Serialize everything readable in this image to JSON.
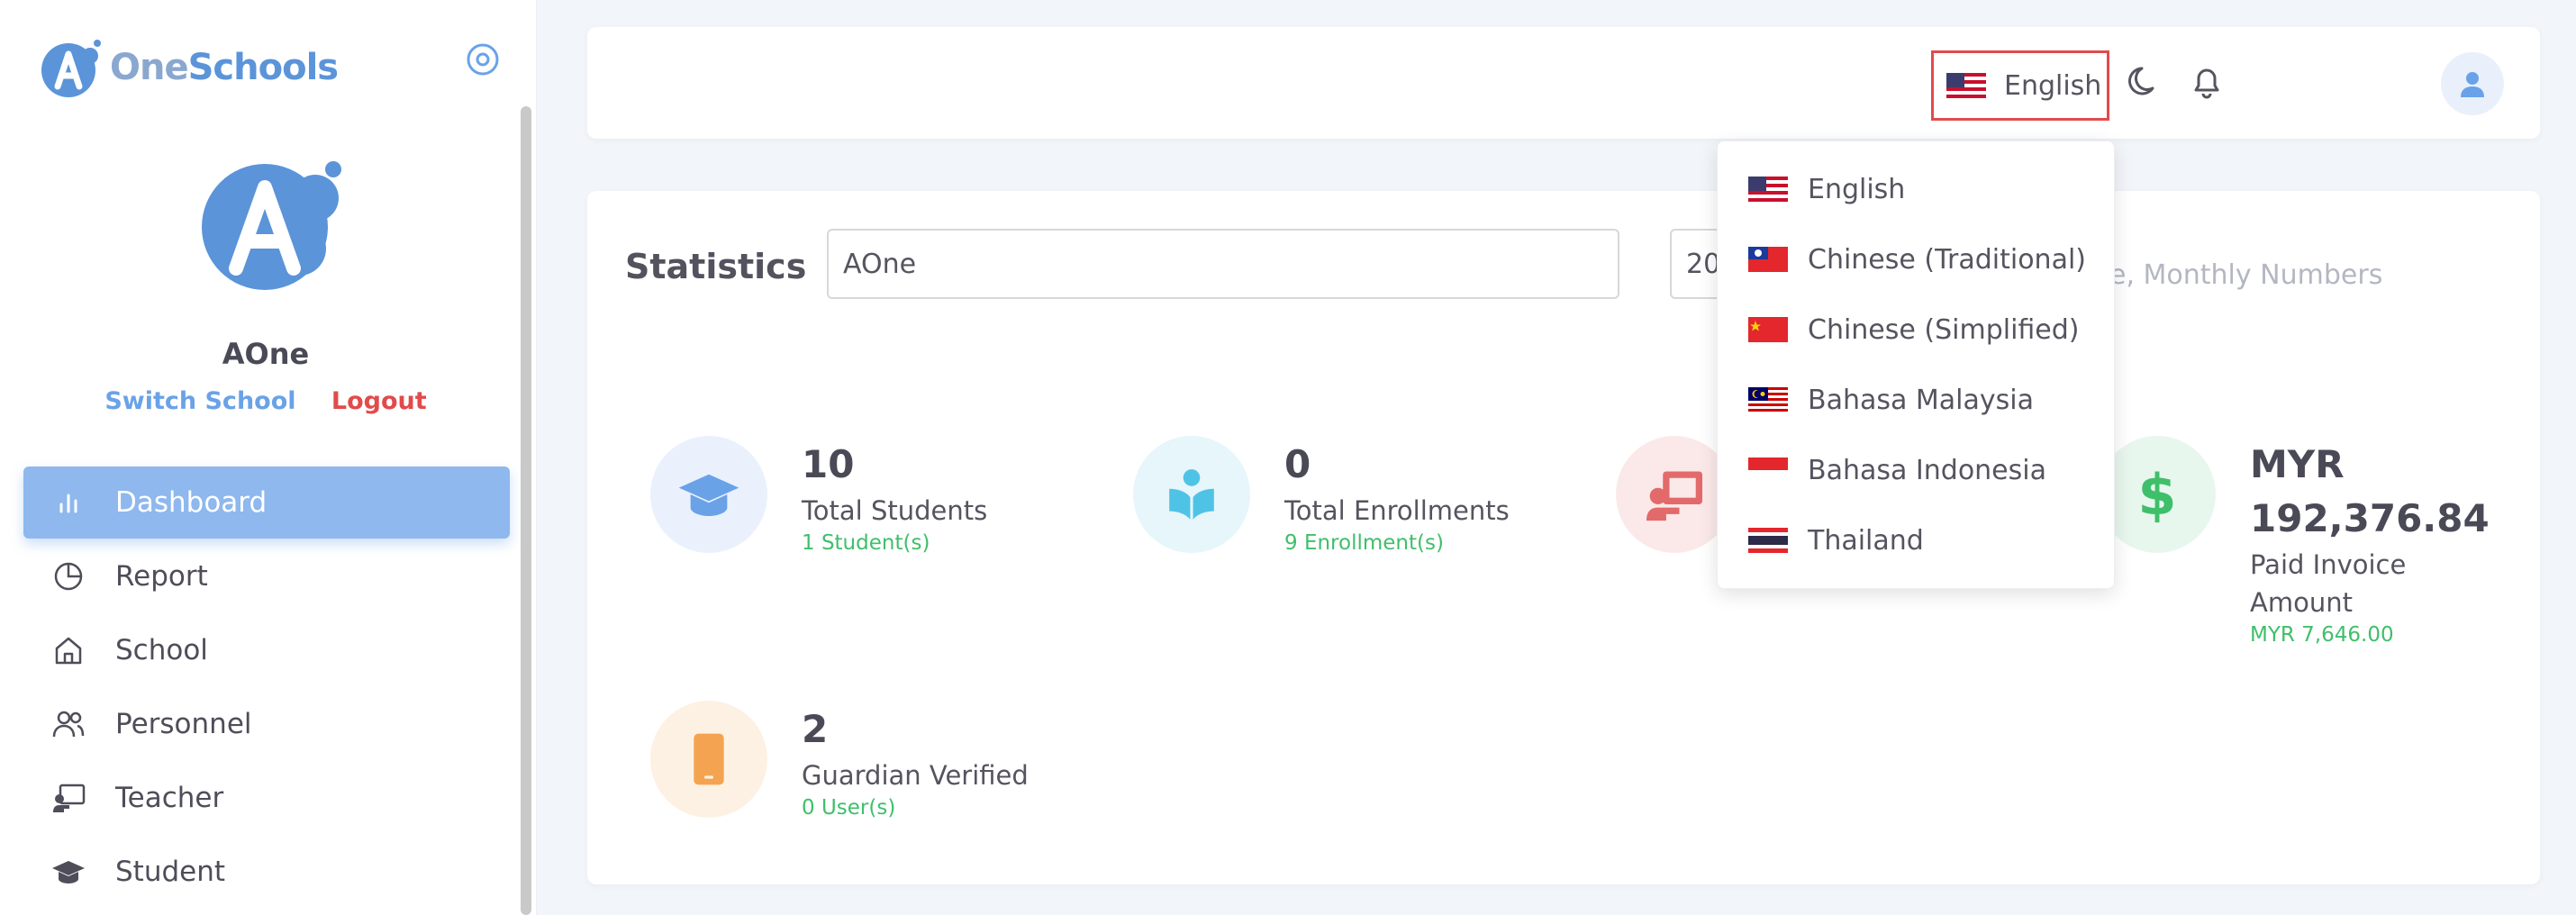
{
  "app": {
    "logo_text_1": "One",
    "logo_text_2": "Schools"
  },
  "sidebar": {
    "school_name": "AOne",
    "switch_school": "Switch School",
    "logout": "Logout",
    "items": [
      {
        "label": "Dashboard",
        "icon": "bar-chart-icon",
        "active": true
      },
      {
        "label": "Report",
        "icon": "pie-chart-icon"
      },
      {
        "label": "School",
        "icon": "home-icon"
      },
      {
        "label": "Personnel",
        "icon": "users-icon"
      },
      {
        "label": "Teacher",
        "icon": "teacher-icon"
      },
      {
        "label": "Student",
        "icon": "graduation-cap-icon"
      }
    ]
  },
  "header": {
    "language": "English"
  },
  "statistics": {
    "title": "Statistics",
    "school_select": "AOne",
    "year_select": "20",
    "chart_hint": "e, Monthly Numbers",
    "cards": [
      {
        "value": "10",
        "label": "Total Students",
        "sub": "1 Student(s)"
      },
      {
        "value": "0",
        "label": "Total Enrollments",
        "sub": "9 Enrollment(s)"
      },
      {
        "value": "MYR 192,376.84",
        "label": "Paid Invoice Amount",
        "sub": "MYR 7,646.00"
      },
      {
        "value": "2",
        "label": "Guardian Verified",
        "sub": "0 User(s)"
      }
    ]
  },
  "language_menu": {
    "options": [
      {
        "label": "English",
        "flag": "us-flag"
      },
      {
        "label": "Chinese (Traditional)",
        "flag": "taiwan-flag"
      },
      {
        "label": "Chinese (Simplified)",
        "flag": "china-flag"
      },
      {
        "label": "Bahasa Malaysia",
        "flag": "malaysia-flag"
      },
      {
        "label": "Bahasa Indonesia",
        "flag": "indonesia-flag"
      },
      {
        "label": "Thailand",
        "flag": "thailand-flag"
      }
    ]
  },
  "colors": {
    "accent": "#8eb8ee",
    "danger": "#e14b4b",
    "success": "#3fbf6a"
  }
}
